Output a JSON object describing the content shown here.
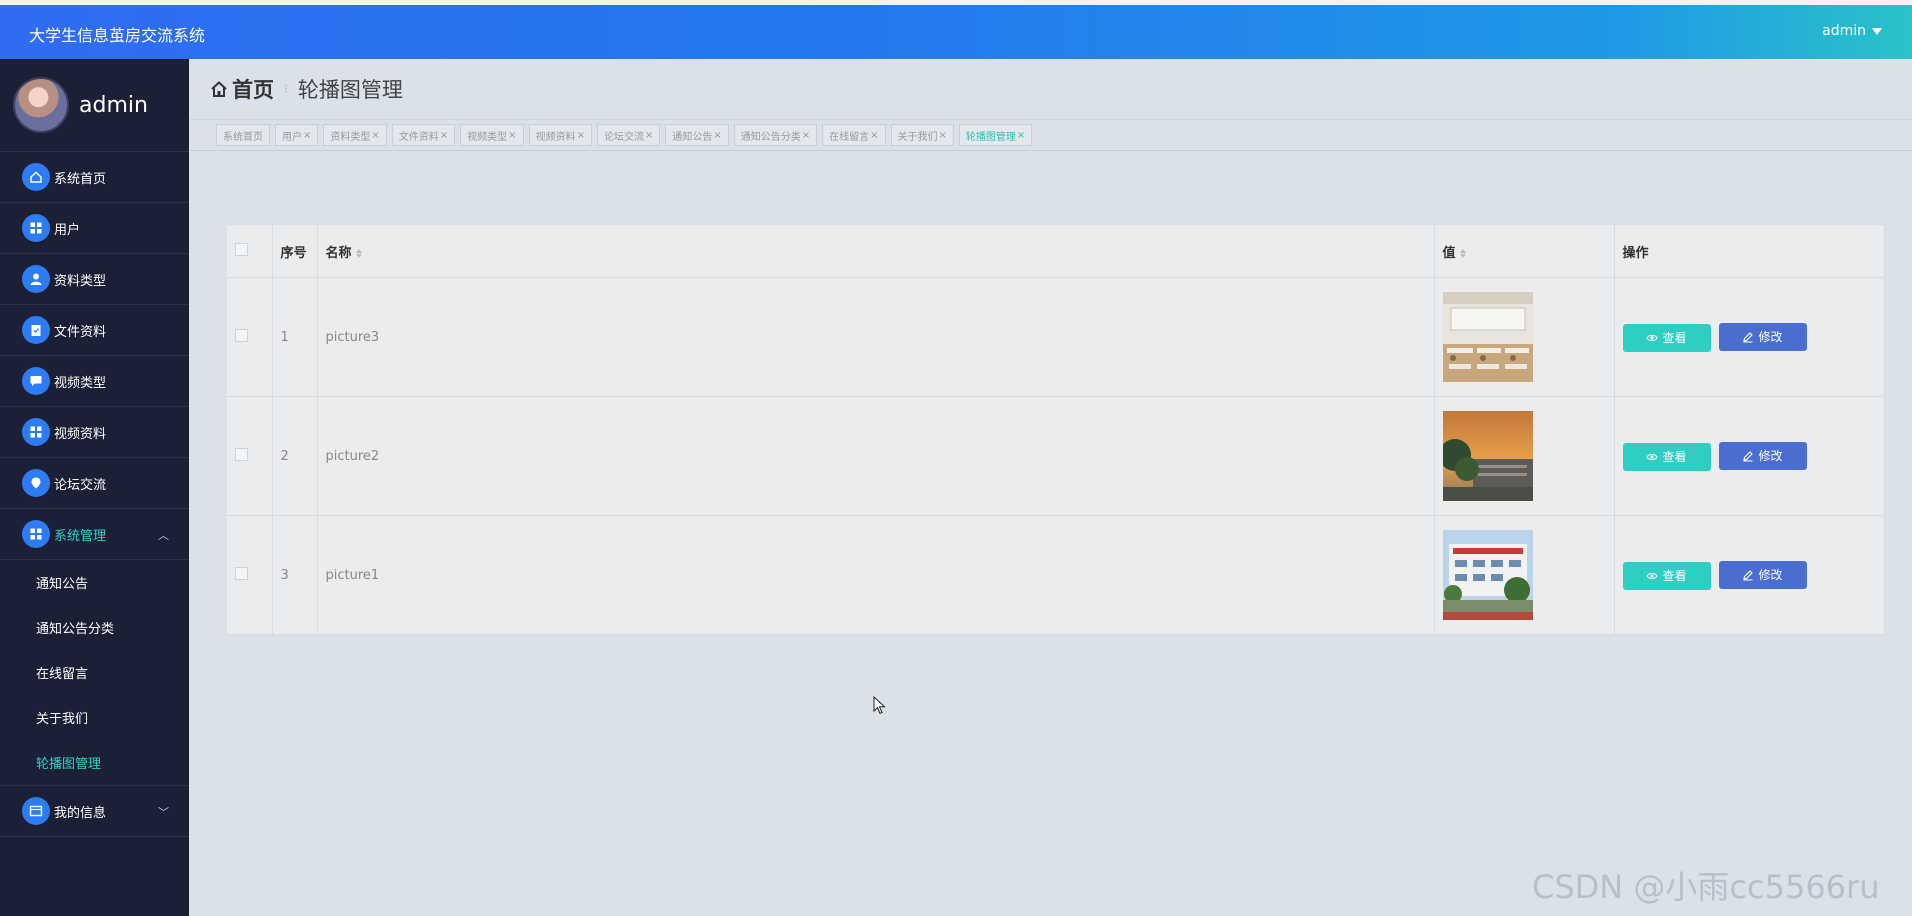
{
  "app": {
    "title": "大学生信息茧房交流系统",
    "user": "admin"
  },
  "sidebar": {
    "username": "admin",
    "items": [
      {
        "label": "系统首页",
        "icon": "home-icon"
      },
      {
        "label": "用户",
        "icon": "grid-icon"
      },
      {
        "label": "资料类型",
        "icon": "user-icon"
      },
      {
        "label": "文件资料",
        "icon": "clipboard-icon"
      },
      {
        "label": "视频类型",
        "icon": "chat-icon"
      },
      {
        "label": "视频资料",
        "icon": "grid-icon"
      },
      {
        "label": "论坛交流",
        "icon": "pin-icon"
      }
    ],
    "group": {
      "label": "系统管理",
      "icon": "grid-icon"
    },
    "subitems": [
      {
        "label": "通知公告"
      },
      {
        "label": "通知公告分类"
      },
      {
        "label": "在线留言"
      },
      {
        "label": "关于我们"
      },
      {
        "label": "轮播图管理",
        "active": true
      }
    ],
    "mine": {
      "label": "我的信息",
      "icon": "card-icon"
    }
  },
  "breadcrumb": {
    "home": "首页",
    "current": "轮播图管理"
  },
  "tabs": [
    {
      "label": "系统首页"
    },
    {
      "label": "用户"
    },
    {
      "label": "资料类型"
    },
    {
      "label": "文件资料"
    },
    {
      "label": "视频类型"
    },
    {
      "label": "视频资料"
    },
    {
      "label": "论坛交流"
    },
    {
      "label": "通知公告"
    },
    {
      "label": "通知公告分类"
    },
    {
      "label": "在线留言"
    },
    {
      "label": "关于我们"
    },
    {
      "label": "轮播图管理",
      "active": true
    }
  ],
  "table": {
    "headers": {
      "index": "序号",
      "name": "名称",
      "value": "值",
      "action": "操作"
    },
    "rows": [
      {
        "index": "1",
        "name": "picture3",
        "image": "classroom-photo"
      },
      {
        "index": "2",
        "name": "picture2",
        "image": "sunset-campus-photo"
      },
      {
        "index": "3",
        "name": "picture1",
        "image": "school-building-photo"
      }
    ],
    "view_label": "查看",
    "edit_label": "修改"
  },
  "watermark": "CSDN @小雨cc5566ru",
  "colors": {
    "header_start": "#2f6cf0",
    "header_end": "#2ac2c9",
    "sidebar": "#1c2037",
    "accent": "#2ad4c5",
    "view_btn": "#2ecfc2",
    "edit_btn": "#4a6ed0"
  }
}
